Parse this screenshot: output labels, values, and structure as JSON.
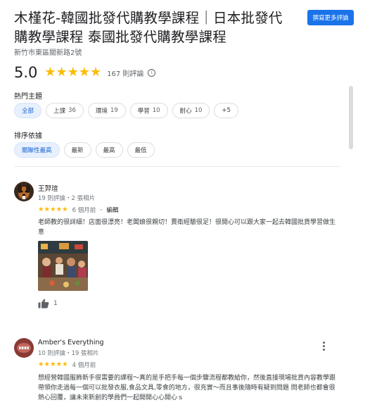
{
  "place": {
    "title": "木槿花-韓國批發代購教學課程｜日本批發代購教學課程 泰國批發代購教學課程",
    "address": "新竹市東區關新路2號",
    "rating": "5.0",
    "review_count": "167 則評論",
    "star_count": 5
  },
  "header": {
    "more_reviews_button": "撰寫更多評論"
  },
  "topics": {
    "label": "熱門主題",
    "chips": [
      {
        "label": "全部",
        "count": ""
      },
      {
        "label": "上課",
        "count": "36"
      },
      {
        "label": "環境",
        "count": "19"
      },
      {
        "label": "學習",
        "count": "10"
      },
      {
        "label": "耐心",
        "count": "10"
      },
      {
        "label": "+5",
        "count": ""
      }
    ]
  },
  "sort": {
    "label": "排序依據",
    "chips": [
      "關聯性最高",
      "最新",
      "最高",
      "最低"
    ]
  },
  "reviews": [
    {
      "name": "王羿瑄",
      "meta": "19 則評論・2 張相片",
      "stars": 5,
      "time": "6 個月前",
      "edited": "編輯",
      "text": "老師教的很詳細！店面很漂亮！老闆娘很親切！賣衛經驗很足！很開心可以跟大家一起去韓國批貨學習做生意",
      "likes": "1"
    },
    {
      "name": "Amber's Everything",
      "meta": "10 則評論・19 張相片",
      "stars": 5,
      "time": "4 個月前",
      "text": "想經營韓國服飾新手很需要的課程～真的是手把手每一個步驟流程都教給你，然後直接現場批貨內容教學跟帶領你走過每一個可以批發衣服,食品文具,零食的地方，很充實～而且事後隨時有疑到問題 問老師也都會很熱心回覆，讓未來新創的學員們一起開開心心開心ｓ"
    }
  ],
  "colors": {
    "accent": "#1a73e8",
    "star": "#fbbc04",
    "chip_active_bg": "#e8f0fe"
  }
}
